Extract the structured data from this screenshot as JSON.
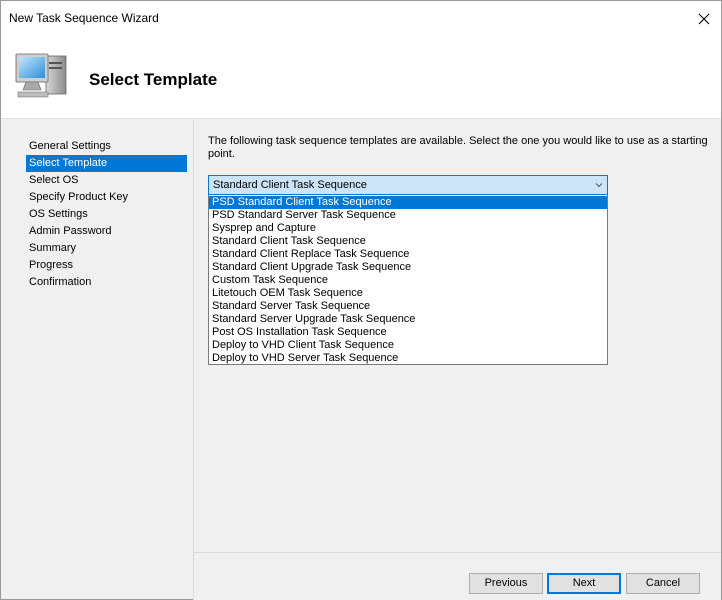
{
  "window": {
    "title": "New Task Sequence Wizard"
  },
  "header": {
    "title": "Select Template",
    "icon": "computer-monitor-icon"
  },
  "nav": {
    "items": [
      {
        "label": "General Settings"
      },
      {
        "label": "Select Template"
      },
      {
        "label": "Select OS"
      },
      {
        "label": "Specify Product Key"
      },
      {
        "label": "OS Settings"
      },
      {
        "label": "Admin Password"
      },
      {
        "label": "Summary"
      },
      {
        "label": "Progress"
      },
      {
        "label": "Confirmation"
      }
    ],
    "active": "Select Template"
  },
  "content": {
    "instructions": "The following task sequence templates are available.  Select the one you would like to use as a starting point.",
    "template_select": {
      "value": "Standard Client Task Sequence",
      "options": [
        "PSD Standard Client Task Sequence",
        "PSD Standard Server Task Sequence",
        "Sysprep and Capture",
        "Standard Client Task Sequence",
        "Standard Client Replace Task Sequence",
        "Standard Client Upgrade Task Sequence",
        "Custom Task Sequence",
        "Litetouch OEM Task Sequence",
        "Standard Server Task Sequence",
        "Standard Server Upgrade Task Sequence",
        "Post OS Installation Task Sequence",
        "Deploy to VHD Client Task Sequence",
        "Deploy to VHD Server Task Sequence"
      ],
      "highlighted": "PSD Standard Client Task Sequence"
    }
  },
  "footer": {
    "previous_label": "Previous",
    "next_label": "Next",
    "cancel_label": "Cancel"
  },
  "colors": {
    "accent": "#0078d7",
    "combo_background": "#cce4f7",
    "panel_background": "#f0f0f0"
  }
}
